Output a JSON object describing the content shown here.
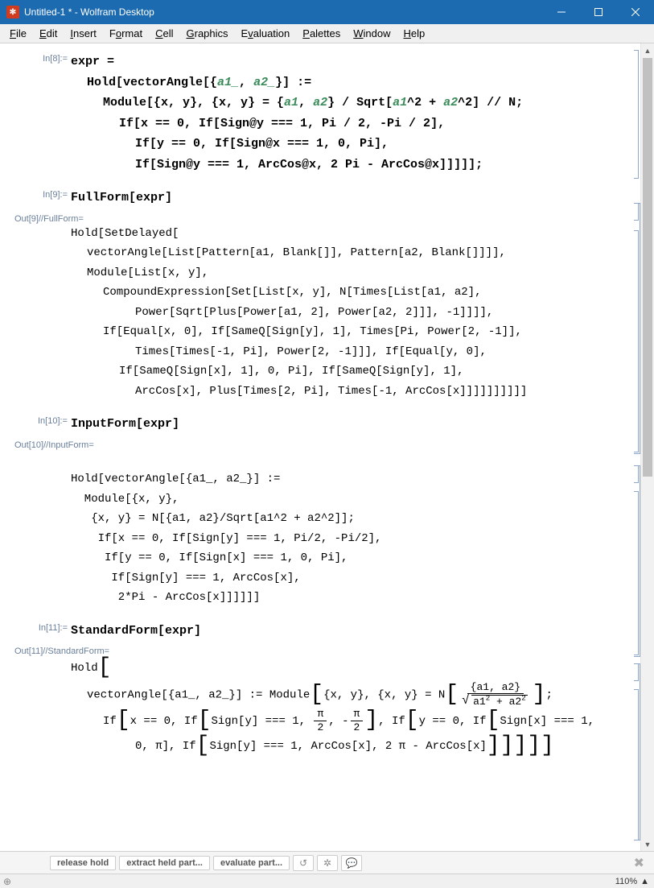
{
  "window": {
    "title": "Untitled-1 * - Wolfram Desktop"
  },
  "menu": {
    "file": "File",
    "edit": "Edit",
    "insert": "Insert",
    "format": "Format",
    "cell": "Cell",
    "graphics": "Graphics",
    "evaluation": "Evaluation",
    "palettes": "Palettes",
    "window": "Window",
    "help": "Help"
  },
  "cells": {
    "in8_label": "In[8]:=",
    "in8_l1a": "expr =",
    "in8_l2a": "Hold[vectorAngle[{",
    "in8_l2b": "a1_",
    "in8_l2c": ", ",
    "in8_l2d": "a2_",
    "in8_l2e": "}] :=",
    "in8_l3a": "Module[{x, y}, {x, y} = {",
    "in8_l3b": "a1",
    "in8_l3c": ", ",
    "in8_l3d": "a2",
    "in8_l3e": "} / Sqrt[",
    "in8_l3f": "a1",
    "in8_l3g": "^2 + ",
    "in8_l3h": "a2",
    "in8_l3i": "^2] // N;",
    "in8_l4": "If[x == 0, If[Sign@y === 1, Pi / 2, -Pi / 2],",
    "in8_l5": "If[y == 0, If[Sign@x === 1, 0, Pi],",
    "in8_l6": "If[Sign@y === 1, ArcCos@x, 2 Pi - ArcCos@x]]]]];",
    "in9_label": "In[9]:=",
    "in9": "FullForm[expr]",
    "out9_label": "Out[9]//FullForm=",
    "out9_l1": "Hold[SetDelayed[",
    "out9_l2": "vectorAngle[List[Pattern[a1, Blank[]], Pattern[a2, Blank[]]]],",
    "out9_l3": "Module[List[x, y],",
    "out9_l4": "CompoundExpression[Set[List[x, y], N[Times[List[a1, a2],",
    "out9_l5": "Power[Sqrt[Plus[Power[a1, 2], Power[a2, 2]]], -1]]]],",
    "out9_l6": "If[Equal[x, 0], If[SameQ[Sign[y], 1], Times[Pi, Power[2, -1]],",
    "out9_l7": "Times[Times[-1, Pi], Power[2, -1]]], If[Equal[y, 0],",
    "out9_l8": "If[SameQ[Sign[x], 1], 0, Pi], If[SameQ[Sign[y], 1],",
    "out9_l9": "ArcCos[x], Plus[Times[2, Pi], Times[-1, ArcCos[x]]]]]]]]]]",
    "in10_label": "In[10]:=",
    "in10": "InputForm[expr]",
    "out10_label": "Out[10]//InputForm=",
    "out10_l1": "Hold[vectorAngle[{a1_, a2_}] := ",
    "out10_l2": "  Module[{x, y}, ",
    "out10_l3": "   {x, y} = N[{a1, a2}/Sqrt[a1^2 + a2^2]]; ",
    "out10_l4": "    If[x == 0, If[Sign[y] === 1, Pi/2, -Pi/2], ",
    "out10_l5": "     If[y == 0, If[Sign[x] === 1, 0, Pi], ",
    "out10_l6": "      If[Sign[y] === 1, ArcCos[x], ",
    "out10_l7": "       2*Pi - ArcCos[x]]]]]]",
    "in11_label": "In[11]:=",
    "in11": "StandardForm[expr]",
    "out11_label": "Out[11]//StandardForm=",
    "out11_hold": "Hold",
    "out11_l2a": "vectorAngle[{a1_, a2_}] := Module",
    "out11_l2b": "{x, y}, {x, y} = N",
    "out11_frac_num": "{a1, a2}",
    "out11_frac_den_a": "a1",
    "out11_frac_den_b": " + a2",
    "out11_l3a": "If",
    "out11_l3b": "x == 0, If",
    "out11_l3c": "Sign[y] === 1, ",
    "out11_pi": "π",
    "out11_two": "2",
    "out11_l3d": ", -",
    "out11_l3e": ", If",
    "out11_l3f": "y == 0, If",
    "out11_l3g": "Sign[x] === 1,",
    "out11_l4a": "0, π], If",
    "out11_l4b": "Sign[y] === 1, ArcCos[x], 2 π - ArcCos[x]"
  },
  "suggestbar": {
    "b1": "release hold",
    "b2": "extract held part...",
    "b3": "evaluate part..."
  },
  "status": {
    "zoom": "110%"
  }
}
